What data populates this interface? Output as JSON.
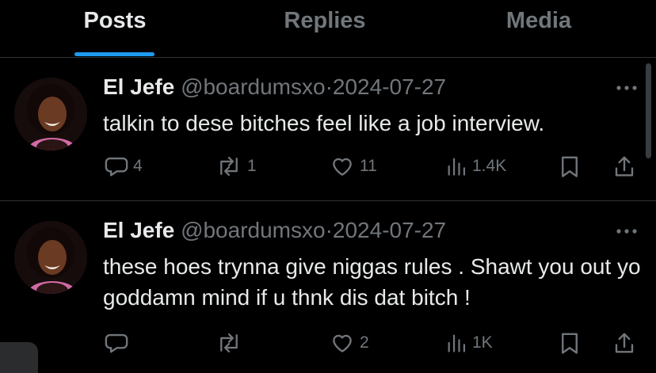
{
  "tabs": [
    {
      "label": "Posts",
      "active": true
    },
    {
      "label": "Replies",
      "active": false
    },
    {
      "label": "Media",
      "active": false
    }
  ],
  "posts": [
    {
      "name": "El Jefe",
      "handle": "@boardumsxo",
      "separator": "·",
      "date": "2024-07-27",
      "text": "talkin to dese bitches feel like a job interview.",
      "replies": "4",
      "reposts": "1",
      "likes": "11",
      "views": "1.4K"
    },
    {
      "name": "El Jefe",
      "handle": "@boardumsxo",
      "separator": "·",
      "date": "2024-07-27",
      "text": "these hoes trynna give niggas rules . Shawt you out yo goddamn mind if u thnk dis dat bitch !",
      "replies": "",
      "reposts": "",
      "likes": "2",
      "views": "1K"
    }
  ],
  "icons": {
    "more": "more-horizontal-icon",
    "reply": "reply-bubble-icon",
    "repost": "repost-icon",
    "like": "heart-icon",
    "views": "bar-chart-icon",
    "bookmark": "bookmark-icon",
    "share": "share-upload-icon"
  },
  "colors": {
    "background": "#000000",
    "text": "#e7e9ea",
    "muted": "#71767b",
    "accent": "#1d9bf0",
    "divider": "#2f3336"
  }
}
